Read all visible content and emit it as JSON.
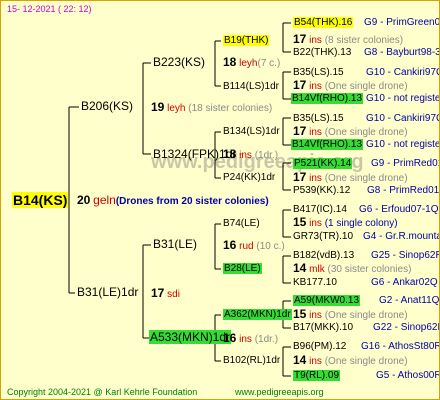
{
  "header": {
    "date": "15- 12-2021 (  22: 12)"
  },
  "root": {
    "label": "B14(KS)",
    "count": "20",
    "trait": "geln",
    "note": "(Drones from 20 sister colonies)"
  },
  "gen1": [
    {
      "label": "B206(KS)",
      "count": "19",
      "trait": "leyh",
      "note": "(18 sister colonies)"
    },
    {
      "label": "B31(LE)1dr",
      "count": "17",
      "trait": "sdi",
      "note": ""
    }
  ],
  "gen2": [
    {
      "label": "B223(KS)",
      "count": "18",
      "trait": "leyh",
      "note": "(7 c.)"
    },
    {
      "label": "B1324(FPK)1dr",
      "count": "18",
      "trait": "ins",
      "note": "(1dr.)"
    },
    {
      "label": "B31(LE)",
      "count": "16",
      "trait": "rud",
      "note": "(10 c.)"
    },
    {
      "label": "A533(MKN)1dr",
      "count": "16",
      "trait": "ins",
      "note": "(1dr.)"
    }
  ],
  "gen3": [
    {
      "label": "B19(THK)"
    },
    {
      "label": "B114(LS)1dr",
      "count": "17",
      "trait": "ins",
      "note": "(One single drone)"
    },
    {
      "label": "B134(LS)1dr",
      "count": "17",
      "trait": "ins",
      "note": "(One single drone)"
    },
    {
      "label": "P24(KK)1dr",
      "count": "17",
      "trait": "ins",
      "note": "(One single drone)"
    },
    {
      "label": "B74(LE)",
      "count": "15",
      "trait": "ins",
      "note": "(1 single colony)"
    },
    {
      "label": "B28(LE)",
      "count": "14",
      "trait": "mlk",
      "note": "(30 sister colonies)"
    },
    {
      "label": "A362(MKN)1dr",
      "count": "15",
      "trait": "ins",
      "note": "(One single drone)"
    },
    {
      "label": "B102(RL)1dr",
      "count": "14",
      "trait": "ins",
      "note": "(One single drone)"
    }
  ],
  "gen4": [
    {
      "label": "B54(THK).16",
      "id": "G9 - PrimGreen00"
    },
    {
      "count": "17",
      "trait": "ins",
      "note": "(8 sister colonies)"
    },
    {
      "label": "B22(THK).13",
      "id": "G8 - Bayburt98-3"
    },
    {
      "label": "B35(LS).15",
      "id": "G10 - Cankiri97Q"
    },
    {
      "label": "B14Vf(RHO).13",
      "id": "G10 - not registe"
    },
    {
      "label": "B35(LS).15",
      "id": "G10 - Cankiri97Q"
    },
    {
      "label": "B14Vf(RHO).13",
      "id": "G10 - not registe"
    },
    {
      "label": "P521(KK).14",
      "id": "G9 - PrimRed01"
    },
    {
      "label": "P539(KK).12",
      "id": "G8 - PrimRed01"
    },
    {
      "label": "B417(IC).14",
      "id": "G6 - Erfoud07-1Q"
    },
    {
      "label": "GR73(TR).10",
      "id": "G4 - Gr.R.mounta"
    },
    {
      "label": "B182(vdB).13",
      "id": "G25 - Sinop62R"
    },
    {
      "label": "KB177.10",
      "id": "G6 - Ankar02Q"
    },
    {
      "label": "A59(MKW0.13",
      "id": "G2 - Anat11Q"
    },
    {
      "label": "B17(MKK).10",
      "id": "G22 - Sinop62R"
    },
    {
      "label": "B96(PM).12",
      "id": "G16 - AthosSt80R"
    },
    {
      "label": "T9(RL).09",
      "id": "G5 - Athos00R"
    }
  ],
  "watermark": "www.pedigreeapis.org",
  "footer": {
    "copyright": "Copyright 2004-2021 @ Karl Kehrle Foundation",
    "url": "www.pedigreeapis.org"
  }
}
